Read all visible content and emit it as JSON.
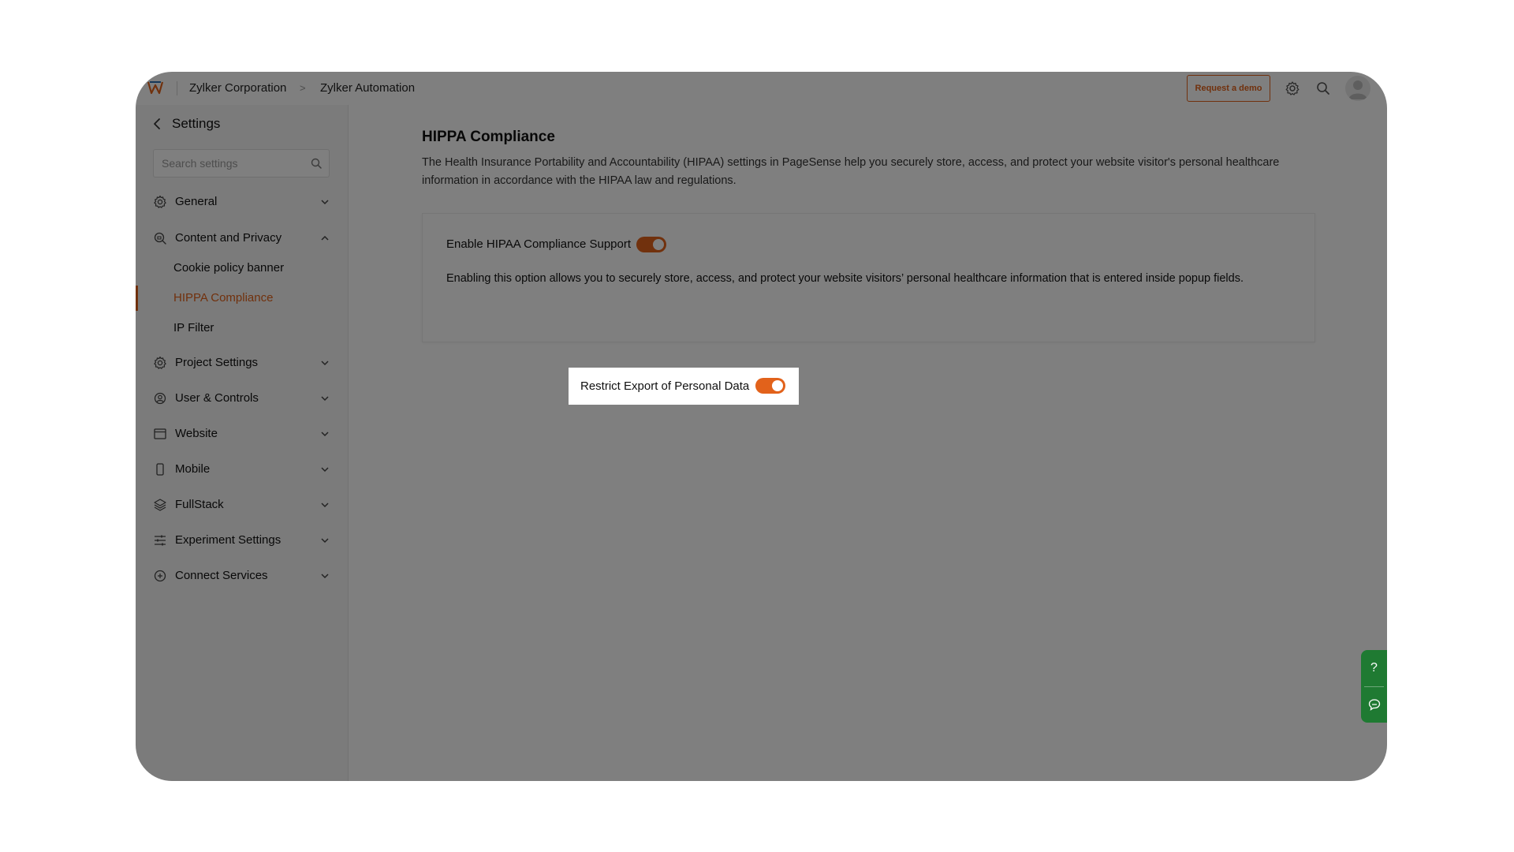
{
  "topbar": {
    "breadcrumb": [
      "Zylker Corporation",
      "Zylker Automation"
    ],
    "request_demo_label": "Request a demo",
    "icons": [
      "settings-icon",
      "search-icon",
      "avatar"
    ]
  },
  "sidebar": {
    "title": "Settings",
    "search_placeholder": "Search settings",
    "items": [
      {
        "label": "General",
        "icon": "gear-icon",
        "expanded": false
      },
      {
        "label": "Content and Privacy",
        "icon": "privacy-icon",
        "expanded": true,
        "children": [
          {
            "label": "Cookie policy banner",
            "active": false
          },
          {
            "label": "HIPPA Compliance",
            "active": true
          },
          {
            "label": "IP Filter",
            "active": false
          }
        ]
      },
      {
        "label": "Project Settings",
        "icon": "gear-icon",
        "expanded": false
      },
      {
        "label": "User & Controls",
        "icon": "user-gear-icon",
        "expanded": false
      },
      {
        "label": "Website",
        "icon": "browser-window-icon",
        "expanded": false
      },
      {
        "label": "Mobile",
        "icon": "mobile-icon",
        "expanded": false
      },
      {
        "label": "FullStack",
        "icon": "layers-icon",
        "expanded": false
      },
      {
        "label": "Experiment Settings",
        "icon": "sliders-icon",
        "expanded": false
      },
      {
        "label": "Connect Services",
        "icon": "connect-icon",
        "expanded": false
      }
    ]
  },
  "main": {
    "title": "HIPPA Compliance",
    "description": "The Health Insurance Portability and Accountability (HIPAA) settings in PageSense help you securely store, access, and protect your website visitor's personal healthcare information in accordance with the HIPAA law and regulations.",
    "card": {
      "enable_label": "Enable HIPAA Compliance Support",
      "enable_on": true,
      "enable_description": "Enabling this option allows you to securely store, access, and protect your website visitors’ personal healthcare information that is entered inside popup fields.",
      "restrict_label": "Restrict Export of Personal Data",
      "restrict_on": true
    }
  },
  "help_dock": {
    "help_glyph": "?",
    "chat_icon": "chat-icon"
  },
  "colors": {
    "accent": "#e2621b",
    "help_green": "#1f7a32",
    "overlay": "rgba(0,0,0,0.5)"
  }
}
